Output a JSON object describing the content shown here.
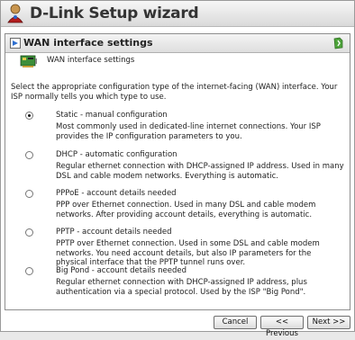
{
  "window": {
    "title": "D-Link Setup wizard"
  },
  "panel": {
    "title": "WAN interface settings"
  },
  "subhead": {
    "text": "WAN interface settings"
  },
  "intro": "Select the appropriate configuration type of the internet-facing (WAN) interface. Your ISP normally tells you which type to use.",
  "options": [
    {
      "label": "Static - manual configuration",
      "desc": "Most commonly used in dedicated-line internet connections. Your ISP provides the IP configuration parameters to you.",
      "selected": true
    },
    {
      "label": "DHCP - automatic configuration",
      "desc": "Regular ethernet connection with DHCP-assigned IP address. Used in many DSL and cable modem networks. Everything is automatic.",
      "selected": false
    },
    {
      "label": "PPPoE - account details needed",
      "desc": "PPP over Ethernet connection. Used in many DSL and cable modem networks. After providing account details, everything is automatic.",
      "selected": false
    },
    {
      "label": "PPTP - account details needed",
      "desc": "PPTP over Ethernet connection. Used in some DSL and cable modem networks. You need account details, but also IP parameters for the physical interface that the PPTP tunnel runs over.",
      "selected": false
    },
    {
      "label": "Big Pond - account details needed",
      "desc": "Regular ethernet connection with DHCP-assigned IP address, plus authentication via a special protocol. Used by the ISP \"Big Pond\".",
      "selected": false
    }
  ],
  "buttons": {
    "cancel": "Cancel",
    "previous": "<< Previous",
    "next": "Next >>"
  }
}
